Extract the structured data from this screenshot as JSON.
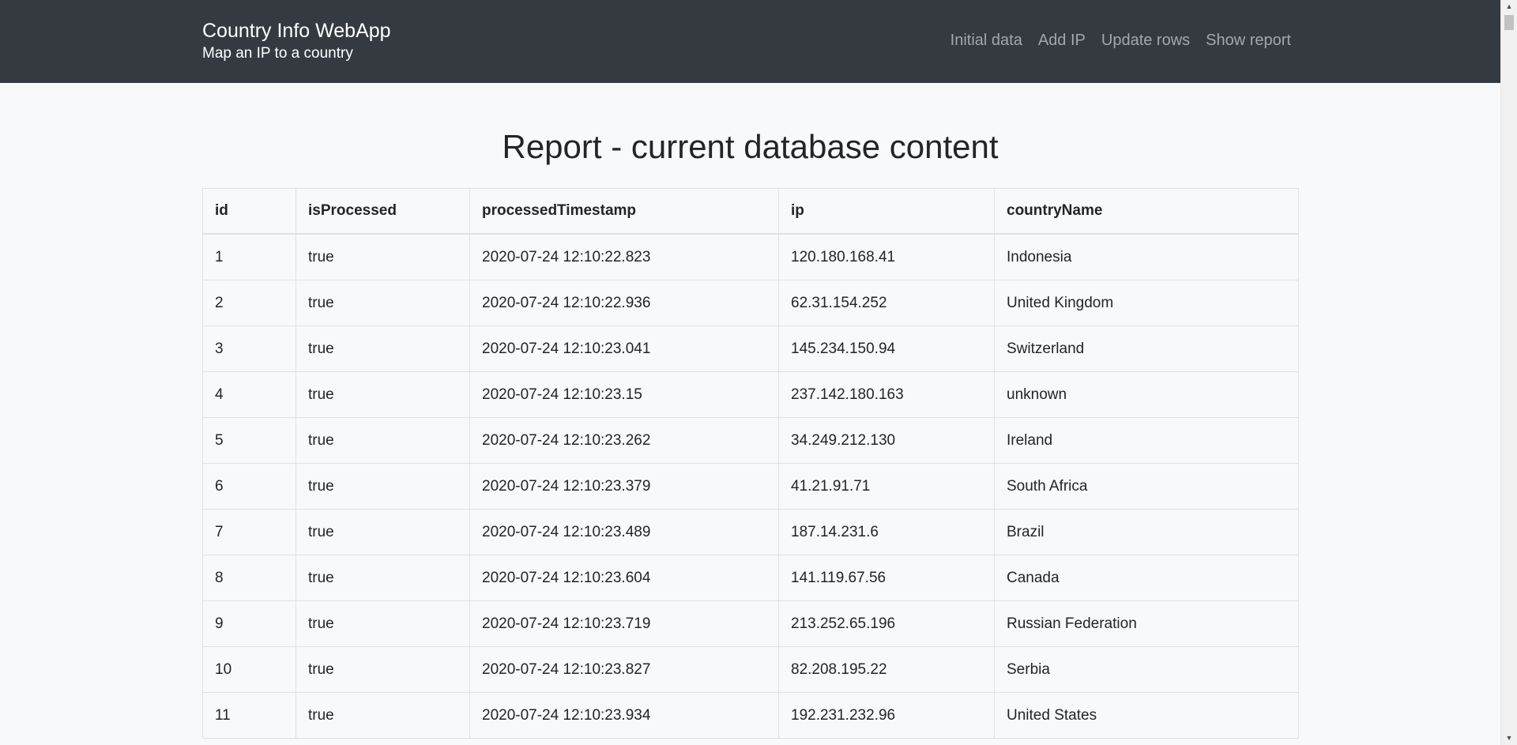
{
  "header": {
    "title": "Country Info WebApp",
    "subtitle": "Map an IP to a country",
    "nav": [
      "Initial data",
      "Add IP",
      "Update rows",
      "Show report"
    ]
  },
  "main": {
    "heading": "Report - current database content",
    "table": {
      "columns": [
        "id",
        "isProcessed",
        "processedTimestamp",
        "ip",
        "countryName"
      ],
      "rows": [
        [
          "1",
          "true",
          "2020-07-24 12:10:22.823",
          "120.180.168.41",
          "Indonesia"
        ],
        [
          "2",
          "true",
          "2020-07-24 12:10:22.936",
          "62.31.154.252",
          "United Kingdom"
        ],
        [
          "3",
          "true",
          "2020-07-24 12:10:23.041",
          "145.234.150.94",
          "Switzerland"
        ],
        [
          "4",
          "true",
          "2020-07-24 12:10:23.15",
          "237.142.180.163",
          "unknown"
        ],
        [
          "5",
          "true",
          "2020-07-24 12:10:23.262",
          "34.249.212.130",
          "Ireland"
        ],
        [
          "6",
          "true",
          "2020-07-24 12:10:23.379",
          "41.21.91.71",
          "South Africa"
        ],
        [
          "7",
          "true",
          "2020-07-24 12:10:23.489",
          "187.14.231.6",
          "Brazil"
        ],
        [
          "8",
          "true",
          "2020-07-24 12:10:23.604",
          "141.119.67.56",
          "Canada"
        ],
        [
          "9",
          "true",
          "2020-07-24 12:10:23.719",
          "213.252.65.196",
          "Russian Federation"
        ],
        [
          "10",
          "true",
          "2020-07-24 12:10:23.827",
          "82.208.195.22",
          "Serbia"
        ],
        [
          "11",
          "true",
          "2020-07-24 12:10:23.934",
          "192.231.232.96",
          "United States"
        ]
      ]
    }
  },
  "scrollbar": {
    "up_icon": "scroll-up-arrow",
    "down_icon": "scroll-down-arrow"
  }
}
